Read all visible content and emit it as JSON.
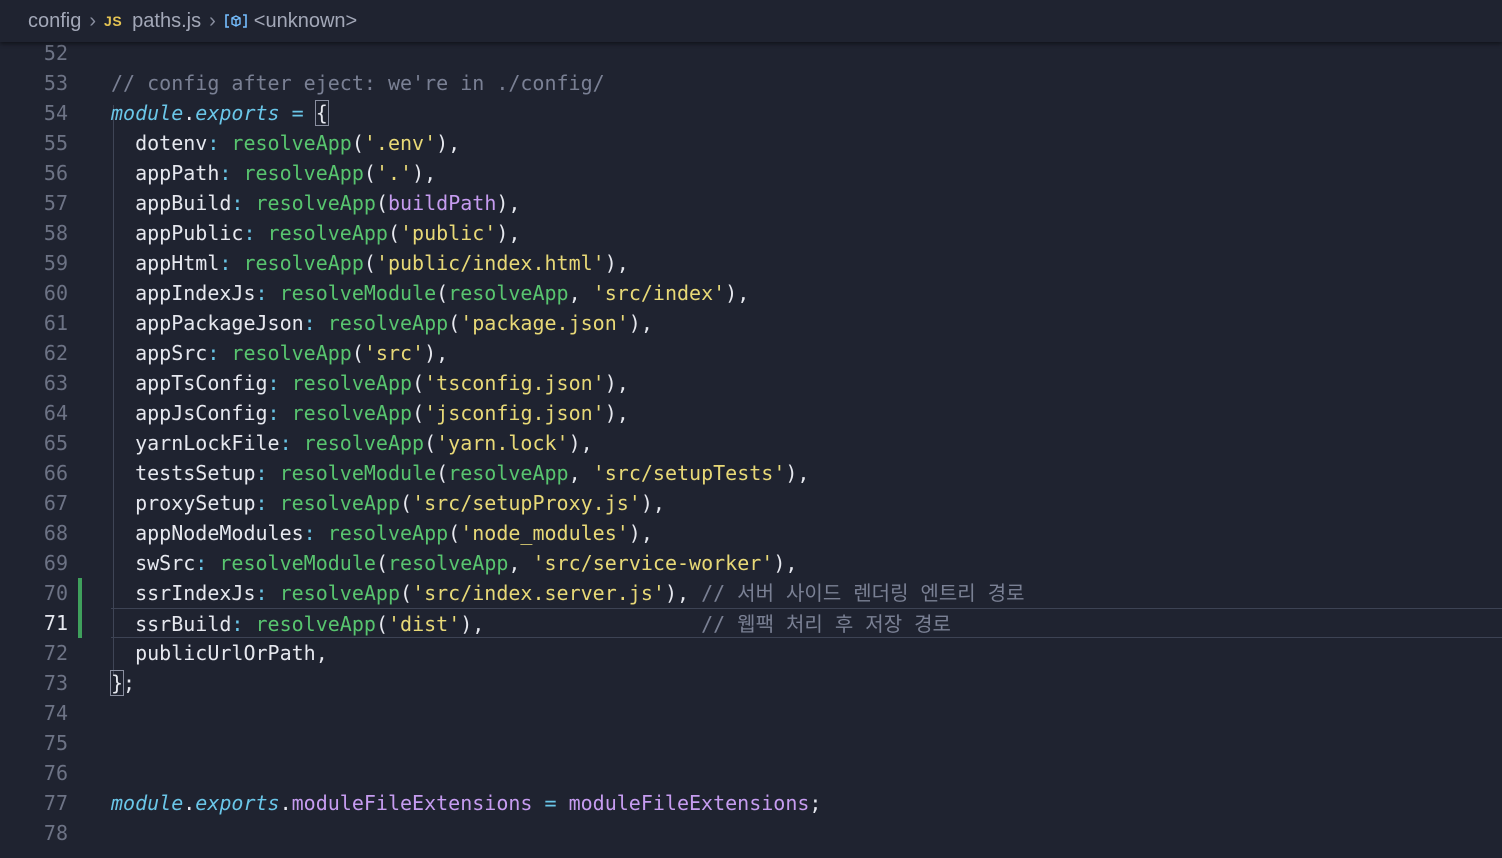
{
  "breadcrumb": {
    "folder": "config",
    "file_icon": "JS",
    "file": "paths.js",
    "symbol_icon": "symbol-variable-icon",
    "symbol": "<unknown>"
  },
  "colors": {
    "background": "#1f2330",
    "git_added": "#3fa05c",
    "function": "#58c56f",
    "string": "#e8d977",
    "keyword": "#6ac6e8",
    "variable": "#c69cf0",
    "comment": "#7a8094"
  },
  "active_line": 71,
  "git_modified_lines": [
    70,
    71
  ],
  "lines": [
    {
      "n": "52",
      "tokens": []
    },
    {
      "n": "53",
      "tokens": [
        {
          "t": "// config after eject: we're in ./config/",
          "c": "c-comment"
        }
      ]
    },
    {
      "n": "54",
      "tokens": [
        {
          "t": "module",
          "c": "c-kw"
        },
        {
          "t": ".",
          "c": "c-punct"
        },
        {
          "t": "exports",
          "c": "c-kw"
        },
        {
          "t": " = ",
          "c": "c-op"
        },
        {
          "t": "{",
          "c": "c-punct brace-hl"
        }
      ]
    },
    {
      "n": "55",
      "tokens": [
        {
          "t": "  dotenv",
          "c": "c-plain"
        },
        {
          "t": ": ",
          "c": "c-op"
        },
        {
          "t": "resolveApp",
          "c": "c-fn"
        },
        {
          "t": "(",
          "c": "c-punct"
        },
        {
          "t": "'.env'",
          "c": "c-str"
        },
        {
          "t": "),",
          "c": "c-punct"
        }
      ]
    },
    {
      "n": "56",
      "tokens": [
        {
          "t": "  appPath",
          "c": "c-plain"
        },
        {
          "t": ": ",
          "c": "c-op"
        },
        {
          "t": "resolveApp",
          "c": "c-fn"
        },
        {
          "t": "(",
          "c": "c-punct"
        },
        {
          "t": "'.'",
          "c": "c-str"
        },
        {
          "t": "),",
          "c": "c-punct"
        }
      ]
    },
    {
      "n": "57",
      "tokens": [
        {
          "t": "  appBuild",
          "c": "c-plain"
        },
        {
          "t": ": ",
          "c": "c-op"
        },
        {
          "t": "resolveApp",
          "c": "c-fn"
        },
        {
          "t": "(",
          "c": "c-punct"
        },
        {
          "t": "buildPath",
          "c": "c-var"
        },
        {
          "t": "),",
          "c": "c-punct"
        }
      ]
    },
    {
      "n": "58",
      "tokens": [
        {
          "t": "  appPublic",
          "c": "c-plain"
        },
        {
          "t": ": ",
          "c": "c-op"
        },
        {
          "t": "resolveApp",
          "c": "c-fn"
        },
        {
          "t": "(",
          "c": "c-punct"
        },
        {
          "t": "'public'",
          "c": "c-str"
        },
        {
          "t": "),",
          "c": "c-punct"
        }
      ]
    },
    {
      "n": "59",
      "tokens": [
        {
          "t": "  appHtml",
          "c": "c-plain"
        },
        {
          "t": ": ",
          "c": "c-op"
        },
        {
          "t": "resolveApp",
          "c": "c-fn"
        },
        {
          "t": "(",
          "c": "c-punct"
        },
        {
          "t": "'public/index.html'",
          "c": "c-str"
        },
        {
          "t": "),",
          "c": "c-punct"
        }
      ]
    },
    {
      "n": "60",
      "tokens": [
        {
          "t": "  appIndexJs",
          "c": "c-plain"
        },
        {
          "t": ": ",
          "c": "c-op"
        },
        {
          "t": "resolveModule",
          "c": "c-fn"
        },
        {
          "t": "(",
          "c": "c-punct"
        },
        {
          "t": "resolveApp",
          "c": "c-fn"
        },
        {
          "t": ", ",
          "c": "c-punct"
        },
        {
          "t": "'src/index'",
          "c": "c-str"
        },
        {
          "t": "),",
          "c": "c-punct"
        }
      ]
    },
    {
      "n": "61",
      "tokens": [
        {
          "t": "  appPackageJson",
          "c": "c-plain"
        },
        {
          "t": ": ",
          "c": "c-op"
        },
        {
          "t": "resolveApp",
          "c": "c-fn"
        },
        {
          "t": "(",
          "c": "c-punct"
        },
        {
          "t": "'package.json'",
          "c": "c-str"
        },
        {
          "t": "),",
          "c": "c-punct"
        }
      ]
    },
    {
      "n": "62",
      "tokens": [
        {
          "t": "  appSrc",
          "c": "c-plain"
        },
        {
          "t": ": ",
          "c": "c-op"
        },
        {
          "t": "resolveApp",
          "c": "c-fn"
        },
        {
          "t": "(",
          "c": "c-punct"
        },
        {
          "t": "'src'",
          "c": "c-str"
        },
        {
          "t": "),",
          "c": "c-punct"
        }
      ]
    },
    {
      "n": "63",
      "tokens": [
        {
          "t": "  appTsConfig",
          "c": "c-plain"
        },
        {
          "t": ": ",
          "c": "c-op"
        },
        {
          "t": "resolveApp",
          "c": "c-fn"
        },
        {
          "t": "(",
          "c": "c-punct"
        },
        {
          "t": "'tsconfig.json'",
          "c": "c-str"
        },
        {
          "t": "),",
          "c": "c-punct"
        }
      ]
    },
    {
      "n": "64",
      "tokens": [
        {
          "t": "  appJsConfig",
          "c": "c-plain"
        },
        {
          "t": ": ",
          "c": "c-op"
        },
        {
          "t": "resolveApp",
          "c": "c-fn"
        },
        {
          "t": "(",
          "c": "c-punct"
        },
        {
          "t": "'jsconfig.json'",
          "c": "c-str"
        },
        {
          "t": "),",
          "c": "c-punct"
        }
      ]
    },
    {
      "n": "65",
      "tokens": [
        {
          "t": "  yarnLockFile",
          "c": "c-plain"
        },
        {
          "t": ": ",
          "c": "c-op"
        },
        {
          "t": "resolveApp",
          "c": "c-fn"
        },
        {
          "t": "(",
          "c": "c-punct"
        },
        {
          "t": "'yarn.lock'",
          "c": "c-str"
        },
        {
          "t": "),",
          "c": "c-punct"
        }
      ]
    },
    {
      "n": "66",
      "tokens": [
        {
          "t": "  testsSetup",
          "c": "c-plain"
        },
        {
          "t": ": ",
          "c": "c-op"
        },
        {
          "t": "resolveModule",
          "c": "c-fn"
        },
        {
          "t": "(",
          "c": "c-punct"
        },
        {
          "t": "resolveApp",
          "c": "c-fn"
        },
        {
          "t": ", ",
          "c": "c-punct"
        },
        {
          "t": "'src/setupTests'",
          "c": "c-str"
        },
        {
          "t": "),",
          "c": "c-punct"
        }
      ]
    },
    {
      "n": "67",
      "tokens": [
        {
          "t": "  proxySetup",
          "c": "c-plain"
        },
        {
          "t": ": ",
          "c": "c-op"
        },
        {
          "t": "resolveApp",
          "c": "c-fn"
        },
        {
          "t": "(",
          "c": "c-punct"
        },
        {
          "t": "'src/setupProxy.js'",
          "c": "c-str"
        },
        {
          "t": "),",
          "c": "c-punct"
        }
      ]
    },
    {
      "n": "68",
      "tokens": [
        {
          "t": "  appNodeModules",
          "c": "c-plain"
        },
        {
          "t": ": ",
          "c": "c-op"
        },
        {
          "t": "resolveApp",
          "c": "c-fn"
        },
        {
          "t": "(",
          "c": "c-punct"
        },
        {
          "t": "'node_modules'",
          "c": "c-str"
        },
        {
          "t": "),",
          "c": "c-punct"
        }
      ]
    },
    {
      "n": "69",
      "tokens": [
        {
          "t": "  swSrc",
          "c": "c-plain"
        },
        {
          "t": ": ",
          "c": "c-op"
        },
        {
          "t": "resolveModule",
          "c": "c-fn"
        },
        {
          "t": "(",
          "c": "c-punct"
        },
        {
          "t": "resolveApp",
          "c": "c-fn"
        },
        {
          "t": ", ",
          "c": "c-punct"
        },
        {
          "t": "'src/service-worker'",
          "c": "c-str"
        },
        {
          "t": "),",
          "c": "c-punct"
        }
      ]
    },
    {
      "n": "70",
      "tokens": [
        {
          "t": "  ssrIndexJs",
          "c": "c-plain"
        },
        {
          "t": ": ",
          "c": "c-op"
        },
        {
          "t": "resolveApp",
          "c": "c-fn"
        },
        {
          "t": "(",
          "c": "c-punct"
        },
        {
          "t": "'src/index.server.js'",
          "c": "c-str"
        },
        {
          "t": "), ",
          "c": "c-punct"
        },
        {
          "t": "// 서버 사이드 렌더링 엔트리 경로",
          "c": "c-comment"
        }
      ]
    },
    {
      "n": "71",
      "tokens": [
        {
          "t": "  ssrBuild",
          "c": "c-plain"
        },
        {
          "t": ": ",
          "c": "c-op"
        },
        {
          "t": "resolveApp",
          "c": "c-fn"
        },
        {
          "t": "(",
          "c": "c-punct"
        },
        {
          "t": "'dist'",
          "c": "c-str"
        },
        {
          "t": "),                  ",
          "c": "c-punct"
        },
        {
          "t": "// 웹팩 처리 후 저장 경로",
          "c": "c-comment"
        }
      ]
    },
    {
      "n": "72",
      "tokens": [
        {
          "t": "  publicUrlOrPath,",
          "c": "c-plain"
        }
      ]
    },
    {
      "n": "73",
      "tokens": [
        {
          "t": "}",
          "c": "c-punct brace-hl"
        },
        {
          "t": ";",
          "c": "c-punct"
        }
      ]
    },
    {
      "n": "74",
      "tokens": []
    },
    {
      "n": "75",
      "tokens": []
    },
    {
      "n": "76",
      "tokens": []
    },
    {
      "n": "77",
      "tokens": [
        {
          "t": "module",
          "c": "c-kw"
        },
        {
          "t": ".",
          "c": "c-punct"
        },
        {
          "t": "exports",
          "c": "c-kw"
        },
        {
          "t": ".",
          "c": "c-punct"
        },
        {
          "t": "moduleFileExtensions",
          "c": "c-var"
        },
        {
          "t": " = ",
          "c": "c-op"
        },
        {
          "t": "moduleFileExtensions",
          "c": "c-var"
        },
        {
          "t": ";",
          "c": "c-punct"
        }
      ]
    },
    {
      "n": "78",
      "tokens": []
    }
  ]
}
